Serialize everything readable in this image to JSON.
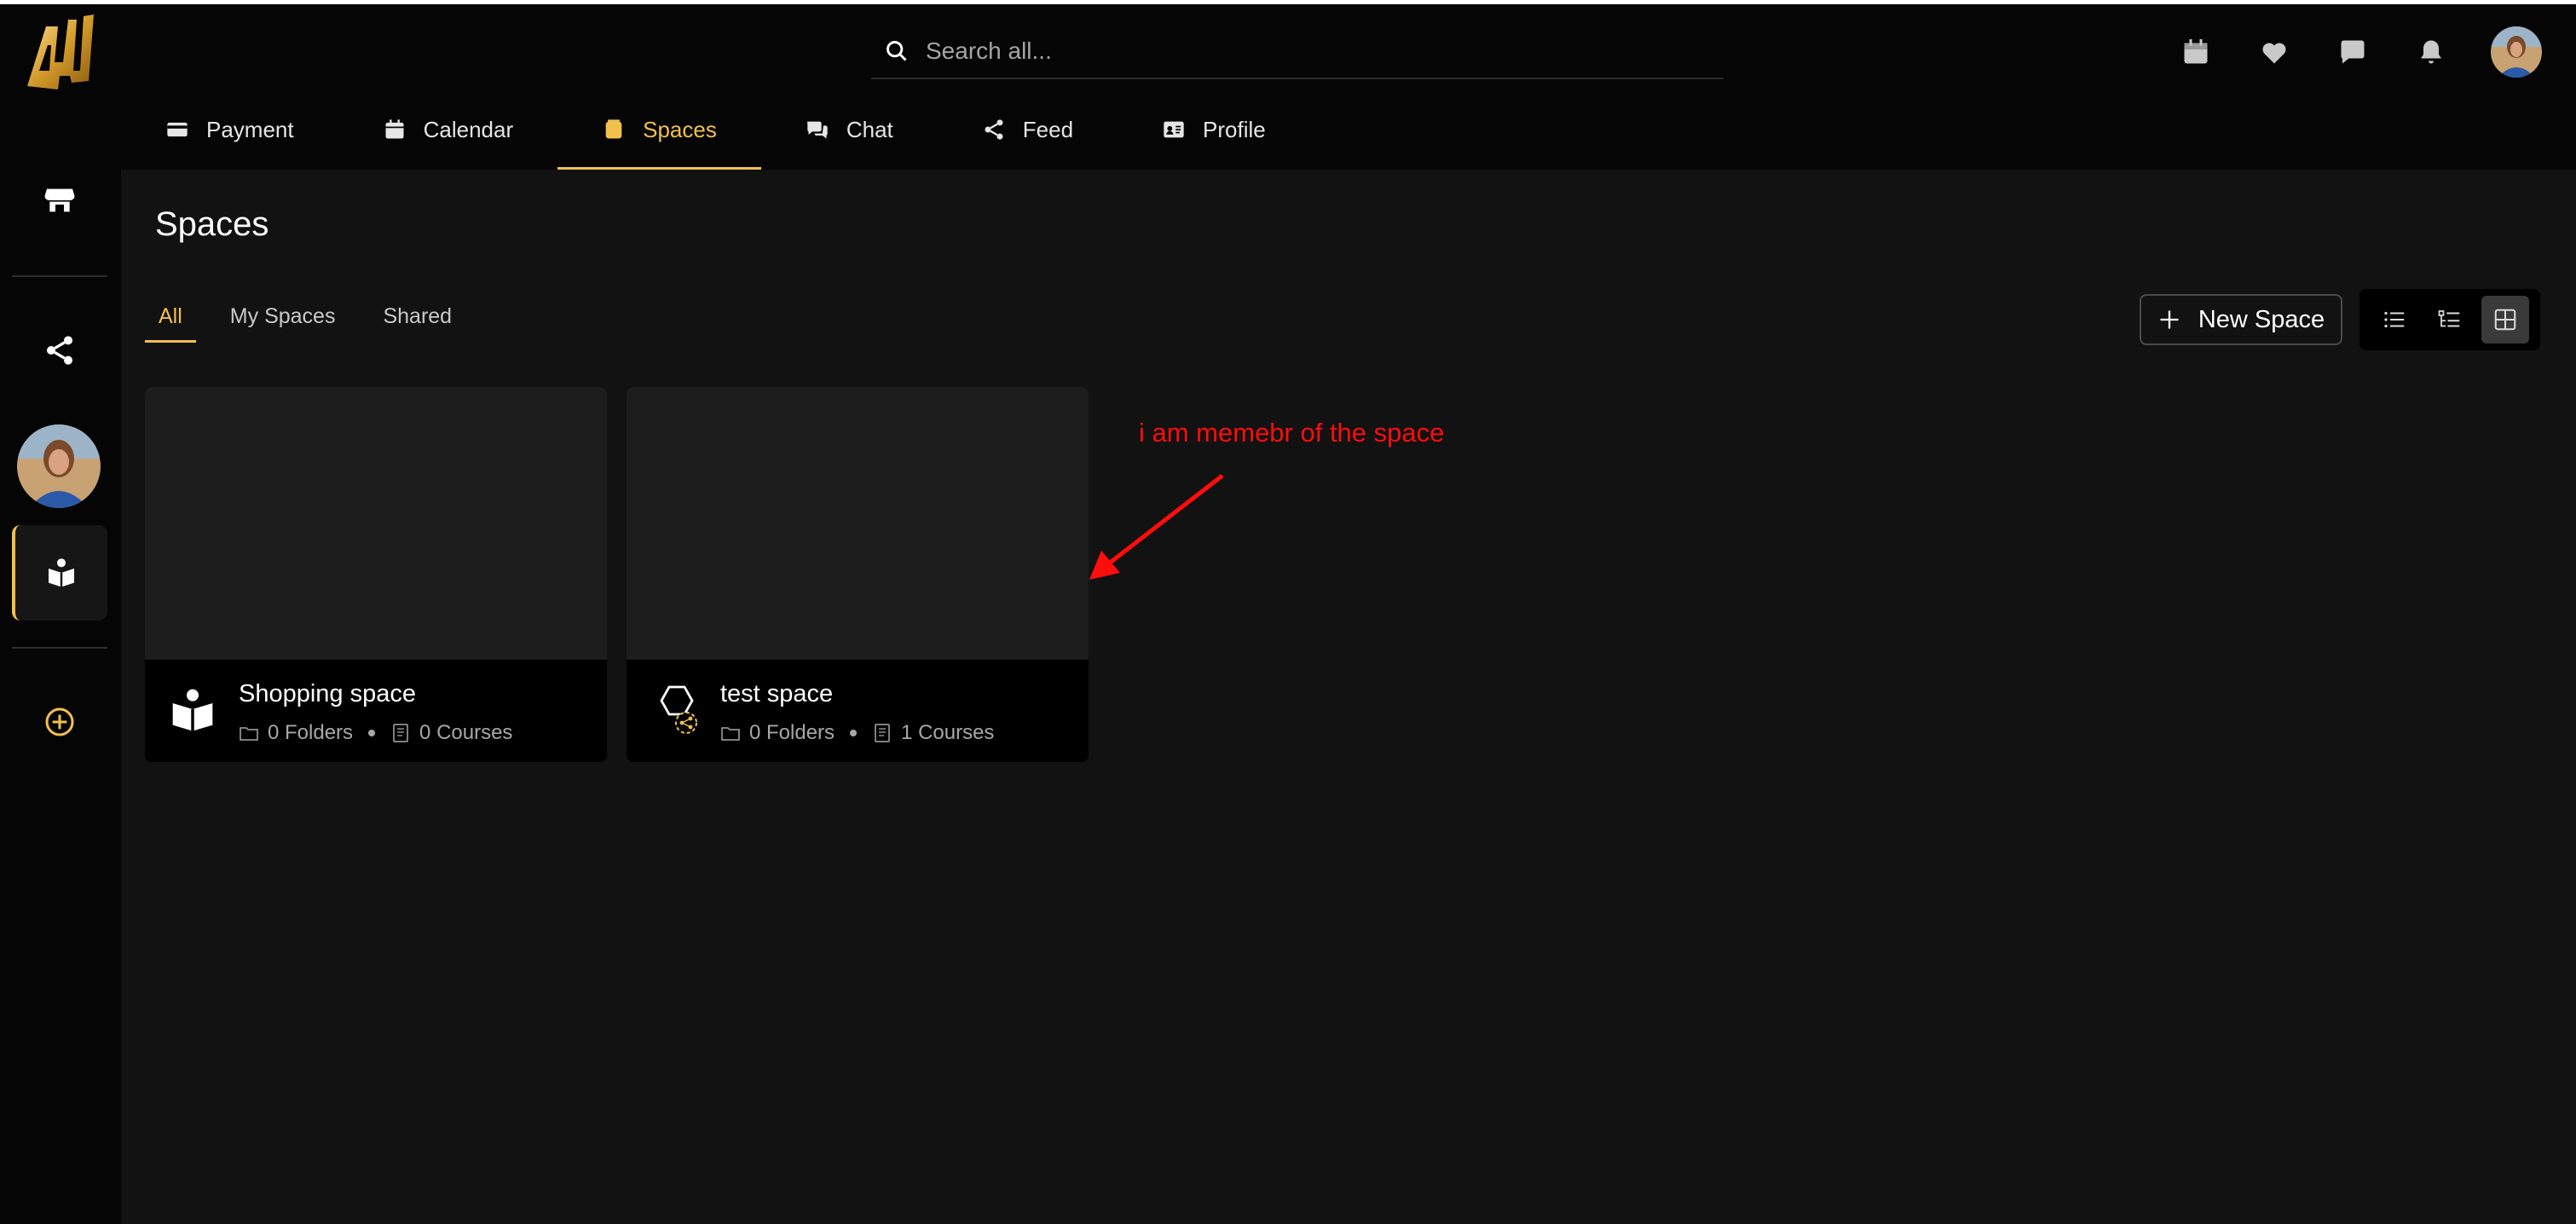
{
  "search": {
    "placeholder": "Search all..."
  },
  "nav": [
    {
      "label": "Payment",
      "icon": "credit-card-icon"
    },
    {
      "label": "Calendar",
      "icon": "calendar-icon"
    },
    {
      "label": "Spaces",
      "icon": "spaces-icon",
      "active": true
    },
    {
      "label": "Chat",
      "icon": "chat-icon"
    },
    {
      "label": "Feed",
      "icon": "share-icon"
    },
    {
      "label": "Profile",
      "icon": "id-card-icon"
    }
  ],
  "top_icons": [
    "calendar-icon",
    "heart-icon",
    "chat-bubble-icon",
    "bell-icon",
    "avatar"
  ],
  "rail": [
    "store-icon",
    "share-icon",
    "avatar",
    "reader-icon",
    "add-circle-icon"
  ],
  "page": {
    "title": "Spaces",
    "tabs": [
      "All",
      "My Spaces",
      "Shared"
    ],
    "active_tab": "All",
    "new_space_label": "New Space",
    "views": [
      "list-icon",
      "tree-list-icon",
      "grid-icon"
    ],
    "active_view": "grid-icon"
  },
  "cards": [
    {
      "name": "Shopping space",
      "folders": "0 Folders",
      "courses": "0 Courses",
      "icon": "reader-icon"
    },
    {
      "name": "test space",
      "folders": "0 Folders",
      "courses": "1 Courses",
      "icon": "hexagon-shared-icon"
    }
  ],
  "annotation": {
    "text": "i am memebr of the space"
  },
  "colors": {
    "accent": "#f2c04d",
    "annotation": "#ff0d0d",
    "background": "#121212"
  }
}
